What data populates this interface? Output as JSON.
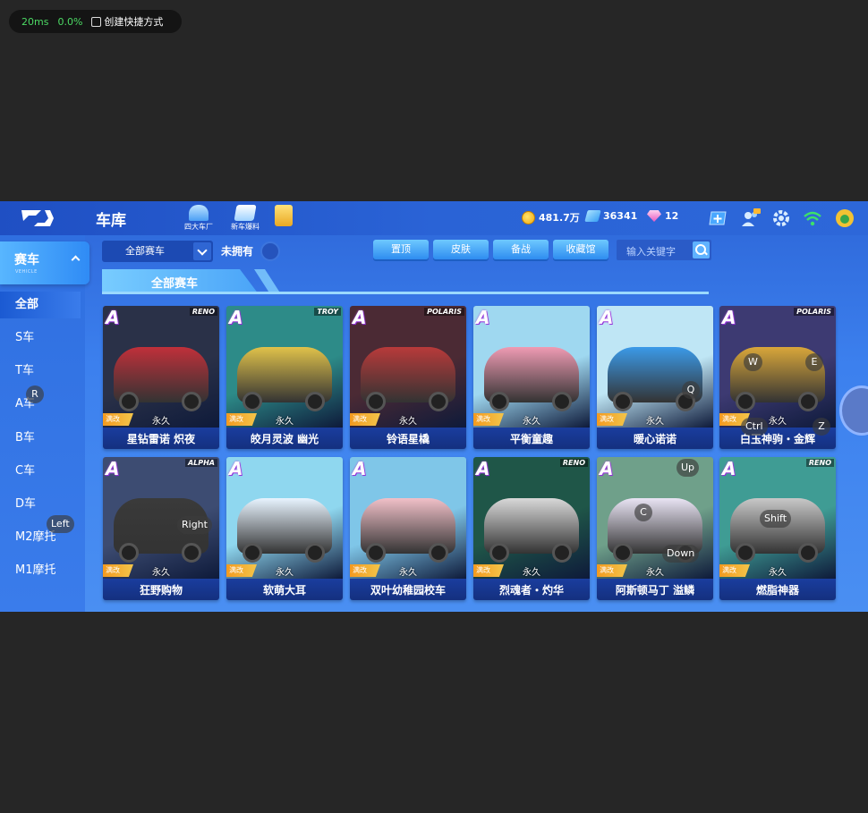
{
  "overlay": {
    "ping": "20ms",
    "loss": "0.0%",
    "shortcut_label": "创建快捷方式"
  },
  "header": {
    "title": "车库",
    "icons": [
      {
        "label": "四大车厂",
        "icon": "factory-icon"
      },
      {
        "label": "新车爆料",
        "icon": "new-car-icon"
      },
      {
        "label": "",
        "icon": "gift-icon"
      }
    ],
    "gold": "481.7万",
    "diamonds": "36341",
    "gems": "12"
  },
  "sidebar": {
    "title": "赛车",
    "subtitle": "VEHICLE",
    "items": [
      {
        "label": "全部",
        "active": true
      },
      {
        "label": "S车"
      },
      {
        "label": "T车"
      },
      {
        "label": "A车"
      },
      {
        "label": "B车"
      },
      {
        "label": "C车"
      },
      {
        "label": "D车"
      },
      {
        "label": "M2摩托"
      },
      {
        "label": "M1摩托"
      }
    ]
  },
  "filters": {
    "select_value": "全部赛车",
    "unowned_label": "未拥有",
    "tabs": [
      "置顶",
      "皮肤",
      "备战",
      "收藏馆"
    ],
    "search_placeholder": "输入关键字"
  },
  "section_title": "全部赛车",
  "cards": [
    {
      "name": "星钻雷诺 炽夜",
      "grade": "A",
      "brand": "RENO",
      "mod": "满改",
      "duration": "永久",
      "colors": [
        "#2a3148",
        "#c0303a"
      ]
    },
    {
      "name": "皎月灵波 幽光",
      "grade": "A",
      "brand": "TROY",
      "mod": "满改",
      "duration": "永久",
      "colors": [
        "#2d8b88",
        "#e0c24a"
      ]
    },
    {
      "name": "铃语星橇",
      "grade": "A",
      "brand": "POLARIS",
      "mod": "满改",
      "duration": "永久",
      "colors": [
        "#4b2a34",
        "#b83a3a"
      ]
    },
    {
      "name": "平衡童趣",
      "grade": "A",
      "brand": "",
      "mod": "满改",
      "duration": "永久",
      "colors": [
        "#9fd8f0",
        "#ef9bb3"
      ]
    },
    {
      "name": "暖心诺诺",
      "grade": "A",
      "brand": "",
      "mod": "满改",
      "duration": "永久",
      "colors": [
        "#bfe6f5",
        "#3b9ae8"
      ]
    },
    {
      "name": "白玉神驹・金辉",
      "grade": "A",
      "brand": "POLARIS",
      "mod": "满改",
      "duration": "永久",
      "colors": [
        "#3d3a72",
        "#d9a73a"
      ]
    },
    {
      "name": "狂野购物",
      "grade": "A",
      "brand": "ALPHA",
      "mod": "满改",
      "duration": "永久",
      "colors": [
        "#3d4c72",
        "#3a3a3a"
      ]
    },
    {
      "name": "软萌大耳",
      "grade": "A",
      "brand": "",
      "mod": "满改",
      "duration": "永久",
      "colors": [
        "#8fd7ef",
        "#e8f4ff"
      ]
    },
    {
      "name": "双叶幼稚园校车",
      "grade": "A",
      "brand": "",
      "mod": "满改",
      "duration": "永久",
      "colors": [
        "#7fc6e8",
        "#f1c0c8"
      ]
    },
    {
      "name": "烈魂者・灼华",
      "grade": "A",
      "brand": "RENO",
      "mod": "满改",
      "duration": "永久",
      "colors": [
        "#1f5648",
        "#d8d8d8"
      ]
    },
    {
      "name": "阿斯顿马丁 溢鳞",
      "grade": "A",
      "brand": "",
      "mod": "满改",
      "duration": "永久",
      "colors": [
        "#6fa08a",
        "#e9e4f4"
      ]
    },
    {
      "name": "燃脂神器",
      "grade": "A",
      "brand": "RENO",
      "mod": "满改",
      "duration": "永久",
      "colors": [
        "#3f9c94",
        "#c8c8c8"
      ]
    }
  ],
  "key_hints": [
    "R",
    "Left",
    "Right",
    "W",
    "E",
    "Q",
    "Ctrl",
    "Z",
    "Up",
    "C",
    "Down",
    "Shift"
  ],
  "accent": "#2d67d9"
}
